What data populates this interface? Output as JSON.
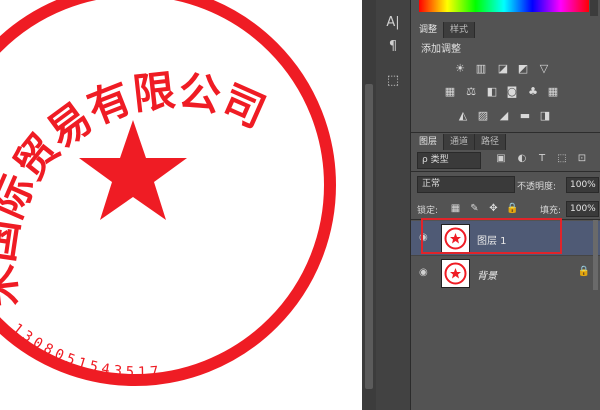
{
  "canvas": {
    "seal": {
      "arc_text": "米国际贸易有限公司",
      "number_text": "13080515435​17",
      "color": "#ef1c24"
    }
  },
  "toolstrip": {
    "icons": [
      "type-icon",
      "paragraph-icon",
      "cube-icon"
    ],
    "glyphs": [
      "A|",
      "¶",
      "⬚"
    ]
  },
  "adjustments": {
    "tabs": [
      "调整",
      "样式"
    ],
    "title": "添加调整"
  },
  "layers_panel": {
    "tabs": [
      "图层",
      "通道",
      "路径"
    ],
    "filter_label": "ρ 类型",
    "blend_mode": "正常",
    "opacity_label": "不透明度:",
    "opacity_value": "100%",
    "lock_label": "锁定:",
    "fill_label": "填充:",
    "fill_value": "100%",
    "layers": [
      {
        "name": "图层 1",
        "selected": true
      },
      {
        "name": "背景",
        "selected": false,
        "locked": true
      }
    ]
  },
  "colors": {
    "accent_selection": "#e0242a",
    "seal_red": "#ef1c24",
    "panel_bg": "#535353"
  }
}
